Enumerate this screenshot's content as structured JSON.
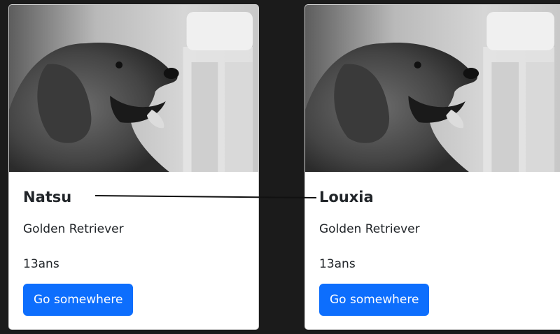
{
  "cards": [
    {
      "photo_alt": "golden retriever photo",
      "name": "Natsu",
      "breed": "Golden Retriever",
      "age": "13ans",
      "button_label": "Go somewhere"
    },
    {
      "photo_alt": "golden retriever photo",
      "name": "Louxia",
      "breed": "Golden Retriever",
      "age": "13ans",
      "button_label": "Go somewhere"
    }
  ],
  "colors": {
    "page_background": "#1b1b1b",
    "card_background": "#ffffff",
    "button_primary": "#0d6efd",
    "text": "#212529"
  }
}
